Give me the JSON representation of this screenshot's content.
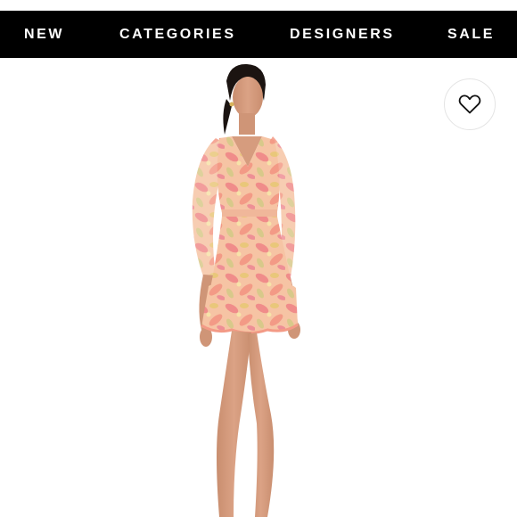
{
  "nav": {
    "items": [
      {
        "label": "NEW"
      },
      {
        "label": "CATEGORIES"
      },
      {
        "label": "DESIGNERS"
      },
      {
        "label": "SALE"
      }
    ],
    "background": "#000000",
    "text_color": "#ffffff"
  },
  "wishlist": {
    "icon": "heart-outline-icon"
  },
  "product": {
    "image": "model-in-floral-mini-dress",
    "dress_colors": [
      "#f2a68f",
      "#f7c6a8",
      "#e9c77a",
      "#f08c8a"
    ]
  }
}
